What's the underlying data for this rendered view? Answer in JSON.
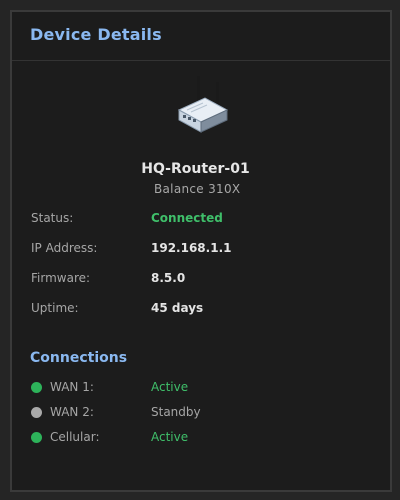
{
  "panel": {
    "title": "Device Details"
  },
  "device": {
    "icon": "router-icon",
    "name": "HQ-Router-01",
    "model": "Balance 310X"
  },
  "details": [
    {
      "label": "Status:",
      "value": "Connected",
      "status": "ok"
    },
    {
      "label": "IP Address:",
      "value": "192.168.1.1"
    },
    {
      "label": "Firmware:",
      "value": "8.5.0"
    },
    {
      "label": "Uptime:",
      "value": "45 days"
    }
  ],
  "connections": {
    "title": "Connections",
    "items": [
      {
        "label": "WAN 1:",
        "state": "Active",
        "dot_color": "#2db35a",
        "active": true
      },
      {
        "label": "WAN 2:",
        "state": "Standby",
        "dot_color": "#a9a9a9",
        "active": false
      },
      {
        "label": "Cellular:",
        "state": "Active",
        "dot_color": "#2db35a",
        "active": true
      }
    ]
  },
  "colors": {
    "accent": "#8ab8f0",
    "success": "#3fbf6a",
    "muted": "#a6a6a6"
  }
}
